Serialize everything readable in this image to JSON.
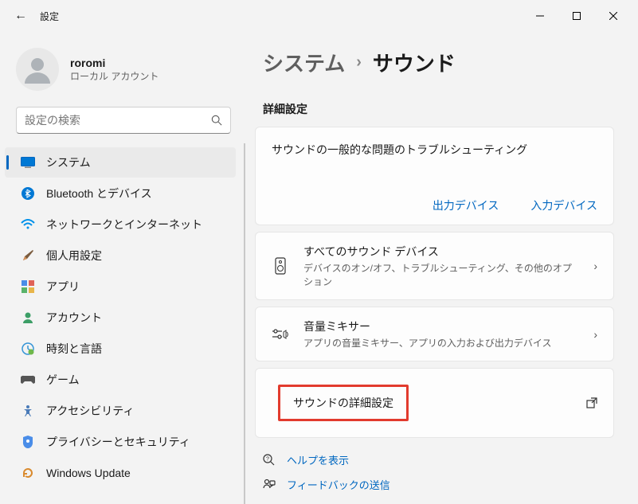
{
  "titlebar": {
    "back": "←",
    "title": "設定"
  },
  "profile": {
    "name": "roromi",
    "sub": "ローカル アカウント"
  },
  "search": {
    "placeholder": "設定の検索"
  },
  "nav": [
    {
      "label": "システム"
    },
    {
      "label": "Bluetooth とデバイス"
    },
    {
      "label": "ネットワークとインターネット"
    },
    {
      "label": "個人用設定"
    },
    {
      "label": "アプリ"
    },
    {
      "label": "アカウント"
    },
    {
      "label": "時刻と言語"
    },
    {
      "label": "ゲーム"
    },
    {
      "label": "アクセシビリティ"
    },
    {
      "label": "プライバシーとセキュリティ"
    },
    {
      "label": "Windows Update"
    }
  ],
  "breadcrumb": {
    "parent": "システム",
    "current": "サウンド"
  },
  "section": "詳細設定",
  "trouble": {
    "title": "サウンドの一般的な問題のトラブルシューティング",
    "out": "出力デバイス",
    "in": "入力デバイス"
  },
  "items": [
    {
      "title": "すべてのサウンド デバイス",
      "sub": "デバイスのオン/オフ、トラブルシューティング、その他のオプション"
    },
    {
      "title": "音量ミキサー",
      "sub": "アプリの音量ミキサー、アプリの入力および出力デバイス"
    }
  ],
  "advanced": "サウンドの詳細設定",
  "footer": {
    "help": "ヘルプを表示",
    "feedback": "フィードバックの送信"
  }
}
